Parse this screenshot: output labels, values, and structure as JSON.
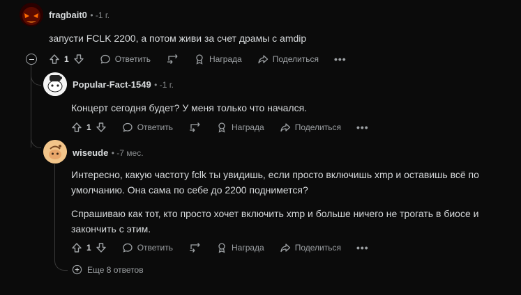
{
  "comments": [
    {
      "author": "fragbait0",
      "time": "• -1 г.",
      "text": "запусти FCLK 2200, а потом живи за счет драмы с amdip",
      "votes": "1"
    },
    {
      "author": "Popular-Fact-1549",
      "time": "• -1 г.",
      "text": "Концерт сегодня будет? У меня только что начался.",
      "votes": "1"
    },
    {
      "author": "wiseude",
      "time": "• -7 мес.",
      "text_p1_line1": "Интересно, какую частоту fclk ты увидишь, если просто включишь xmp и оставишь всё по",
      "text_p1_line2": "умолчанию. Она сама по себе до 2200 поднимется?",
      "text_p2_line1": "Спрашиваю как тот, кто просто хочет включить xmp и больше ничего не трогать в биосе и",
      "text_p2_line2": "закончить с этим.",
      "votes": "1"
    }
  ],
  "actions": {
    "reply": "Ответить",
    "award": "Награда",
    "share": "Поделиться",
    "more": "•••"
  },
  "more_replies": "Еще 8 ответов",
  "colors": {
    "bg": "#0b0b0b",
    "text": "#d7dadc",
    "muted": "#9ea2a5",
    "line": "#3a3a3a"
  }
}
